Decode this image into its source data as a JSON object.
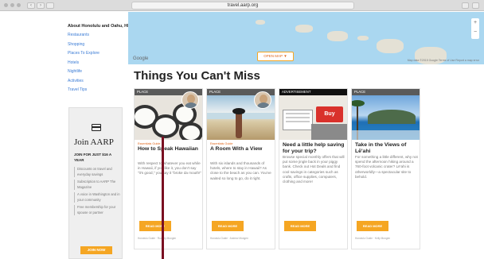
{
  "browser": {
    "url": "travel.aarp.org"
  },
  "sidebar": {
    "title": "About Honolulu and Oahu, HI",
    "items": [
      {
        "label": "Restaurants"
      },
      {
        "label": "Shopping"
      },
      {
        "label": "Places To Explore"
      },
      {
        "label": "Hotels"
      },
      {
        "label": "Nightlife"
      },
      {
        "label": "Activities"
      },
      {
        "label": "Travel Tips"
      }
    ]
  },
  "join": {
    "icon": "credit-card-icon",
    "title": "Join AARP",
    "subtitle": "JOIN FOR JUST $16 A YEAR",
    "bullets": [
      "Discounts on travel and everyday savings",
      "Subscription to AARP The Magazine",
      "A voice in Washington and in your community",
      "Free membership for your spouse or partner"
    ],
    "button": "JOIN NOW"
  },
  "map": {
    "google_label": "Google",
    "button": "OPEN MAP ▼",
    "zoom_in": "+",
    "zoom_out": "−",
    "footer": "Map data ©2015 Google   Terms of Use   Report a map error"
  },
  "main": {
    "heading": "Things You Can't Miss",
    "cards": [
      {
        "label": "PLACE",
        "kicker": "Essentials Guide",
        "title": "How to Speak Hawaiian",
        "body": "With respect to whatever you eat while in Hawaii, if you like it, you don't say \"it's good,\" you say it \"broke da mouth!\"",
        "button": "READ MORE",
        "byline": "Honolulu Guide · Rodney Mungen"
      },
      {
        "label": "PLACE",
        "kicker": "Essentials Guide",
        "title": "A Room With a View",
        "body": "With six islands and thousands of hotels, where to stay in Hawaii? As close to the beach as you can. You've waited so long to go, do it right.",
        "button": "READ MORE",
        "byline": "Honolulu Guide · Andrew Mungen"
      },
      {
        "label": "ADVERTISEMENT",
        "title": "Need a little help saving for your trip?",
        "body": "Browse special monthly offers that will put some jingle back in your piggy bank. Check out Hot Deals and find cool savings in categories such as crafts, office supplies, computers, clothing and more!",
        "button": "READ MORE",
        "ad_button": "Buy"
      },
      {
        "label": "PLACE",
        "title": "Take in the Views of Lē'ahi",
        "body": "For something a little different, why not spend the afternoon hiking around a 760-foot volcanic crater? Lē'ahi is otherworldly—a spectacular site to behold.",
        "button": "READ MORE",
        "byline": "Honolulu Guide · Kelly Mungen"
      }
    ]
  },
  "colors": {
    "accent": "#f5a623",
    "link": "#3a7bd5",
    "label_bar": "#5a5a5a",
    "pointer": "#7a1022"
  }
}
